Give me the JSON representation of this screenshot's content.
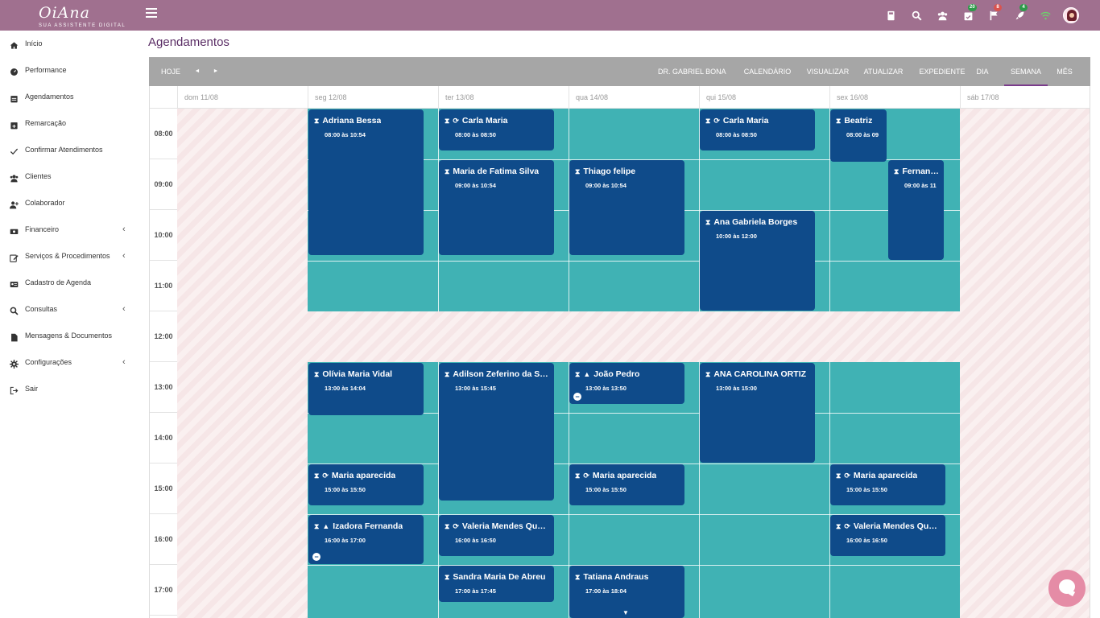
{
  "brand": {
    "name": "OiAna",
    "tagline": "SUA ASSISTENTE DIGITAL"
  },
  "topbar": {
    "icons": [
      {
        "name": "calculator-icon"
      },
      {
        "name": "search-icon"
      },
      {
        "name": "users-icon"
      },
      {
        "name": "calendar-check-icon",
        "badge": "20",
        "badge_color": "#2e9a4a"
      },
      {
        "name": "flag-icon",
        "badge": "8",
        "badge_color": "#d9534f"
      },
      {
        "name": "rocket-icon",
        "badge": "4",
        "badge_color": "#2e9a4a"
      },
      {
        "name": "wifi-icon",
        "color": "#6cd36c"
      }
    ]
  },
  "sidebar": {
    "items": [
      {
        "label": "Início",
        "icon": "home-icon"
      },
      {
        "label": "Performance",
        "icon": "gauge-icon"
      },
      {
        "label": "Agendamentos",
        "icon": "calendar-icon"
      },
      {
        "label": "Remarcação",
        "icon": "calendar-plus-icon"
      },
      {
        "label": "Confirmar Atendimentos",
        "icon": "check-icon"
      },
      {
        "label": "Clientes",
        "icon": "users-icon"
      },
      {
        "label": "Colaborador",
        "icon": "user-plus-icon"
      },
      {
        "label": "Financeiro",
        "icon": "money-icon",
        "expandable": true
      },
      {
        "label": "Serviços & Procedimentos",
        "icon": "edit-icon",
        "expandable": true
      },
      {
        "label": "Cadastro de Agenda",
        "icon": "id-card-icon"
      },
      {
        "label": "Consultas",
        "icon": "search-icon",
        "expandable": true
      },
      {
        "label": "Mensagens & Documentos",
        "icon": "file-icon"
      },
      {
        "label": "Configurações",
        "icon": "gear-icon",
        "expandable": true
      },
      {
        "label": "Sair",
        "icon": "sign-out-icon"
      }
    ]
  },
  "page": {
    "title": "Agendamentos"
  },
  "toolbar": {
    "today": "HOJE",
    "prev": "◄",
    "next": "►",
    "right_buttons": [
      "DR. GABRIEL BONA",
      "CALENDÁRIO",
      "VISUALIZAR",
      "ATUALIZAR",
      "EXPEDIENTE",
      "DIA",
      "SEMANA",
      "MÊS"
    ],
    "active": "SEMANA"
  },
  "calendar": {
    "days": [
      "dom 11/08",
      "seg 12/08",
      "ter 13/08",
      "qua 14/08",
      "qui 15/08",
      "sex 16/08",
      "sáb 17/08"
    ],
    "hours": [
      "08:00",
      "09:00",
      "10:00",
      "11:00",
      "12:00",
      "13:00",
      "14:00",
      "15:00",
      "16:00",
      "17:00"
    ],
    "colors": {
      "appointment": "#0f4b8a",
      "available": "#40b2b4",
      "blocked": "#f6e6e7"
    },
    "events": [
      {
        "day": 1,
        "start": 8.0,
        "end": 10.9,
        "title": "Adriana Bessa",
        "time": "08:00 às 10:54",
        "icons": [
          "hourglass"
        ]
      },
      {
        "day": 2,
        "start": 8.0,
        "end": 8.84,
        "title": "Carla Maria",
        "time": "08:00 às 08:50",
        "icons": [
          "hourglass",
          "repeat"
        ]
      },
      {
        "day": 2,
        "start": 9.0,
        "end": 10.9,
        "title": "Maria de Fatima Silva",
        "time": "09:00 às 10:54",
        "icons": [
          "hourglass"
        ]
      },
      {
        "day": 3,
        "start": 9.0,
        "end": 10.9,
        "title": "Thiago felipe",
        "time": "09:00 às 10:54",
        "icons": [
          "hourglass"
        ]
      },
      {
        "day": 4,
        "start": 8.0,
        "end": 8.84,
        "title": "Carla Maria",
        "time": "08:00 às 08:50",
        "icons": [
          "hourglass",
          "repeat"
        ]
      },
      {
        "day": 4,
        "start": 10.0,
        "end": 12.0,
        "title": "Ana Gabriela Borges",
        "time": "10:00 às 12:00",
        "icons": [
          "hourglass"
        ]
      },
      {
        "day": 5,
        "start": 8.0,
        "end": 9.06,
        "title": "Beatriz",
        "time": "08:00 às 09",
        "icons": [
          "hourglass"
        ],
        "col": "half-left"
      },
      {
        "day": 5,
        "start": 9.0,
        "end": 11.0,
        "title": "Fernanda",
        "time": "09:00 às 11",
        "icons": [
          "hourglass"
        ],
        "col": "half-right"
      },
      {
        "day": 1,
        "start": 13.0,
        "end": 14.07,
        "title": "Olívia Maria Vidal",
        "time": "13:00 às 14:04",
        "icons": [
          "hourglass"
        ]
      },
      {
        "day": 2,
        "start": 13.0,
        "end": 15.75,
        "title": "Adilson Zeferino da Silva",
        "time": "13:00 às 15:45",
        "icons": [
          "hourglass"
        ]
      },
      {
        "day": 3,
        "start": 13.0,
        "end": 13.84,
        "title": "João Pedro",
        "time": "13:00 às 13:50",
        "icons": [
          "hourglass",
          "warning"
        ],
        "more": true
      },
      {
        "day": 4,
        "start": 13.0,
        "end": 15.0,
        "title": "ANA CAROLINA ORTIZ",
        "time": "13:00 às 15:00",
        "icons": [
          "hourglass"
        ]
      },
      {
        "day": 1,
        "start": 15.0,
        "end": 15.84,
        "title": "Maria aparecida",
        "time": "15:00 às 15:50",
        "icons": [
          "hourglass",
          "repeat"
        ]
      },
      {
        "day": 3,
        "start": 15.0,
        "end": 15.84,
        "title": "Maria aparecida",
        "time": "15:00 às 15:50",
        "icons": [
          "hourglass",
          "repeat"
        ]
      },
      {
        "day": 5,
        "start": 15.0,
        "end": 15.84,
        "title": "Maria aparecida",
        "time": "15:00 às 15:50",
        "icons": [
          "hourglass",
          "repeat"
        ]
      },
      {
        "day": 1,
        "start": 16.0,
        "end": 17.0,
        "title": "Izadora Fernanda",
        "time": "16:00 às 17:00",
        "icons": [
          "hourglass",
          "warning"
        ],
        "more": true
      },
      {
        "day": 2,
        "start": 16.0,
        "end": 16.84,
        "title": "Valeria Mendes Queiroz",
        "time": "16:00 às 16:50",
        "icons": [
          "hourglass",
          "repeat"
        ]
      },
      {
        "day": 5,
        "start": 16.0,
        "end": 16.84,
        "title": "Valeria Mendes Queiroz",
        "time": "16:00 às 16:50",
        "icons": [
          "hourglass",
          "repeat"
        ]
      },
      {
        "day": 2,
        "start": 17.0,
        "end": 17.75,
        "title": "Sandra Maria De Abreu",
        "time": "17:00 às 17:45",
        "icons": [
          "hourglass"
        ]
      },
      {
        "day": 3,
        "start": 17.0,
        "end": 18.07,
        "title": "Tatiana Andraus",
        "time": "17:00 às 18:04",
        "icons": [
          "hourglass"
        ],
        "down": true
      }
    ]
  }
}
